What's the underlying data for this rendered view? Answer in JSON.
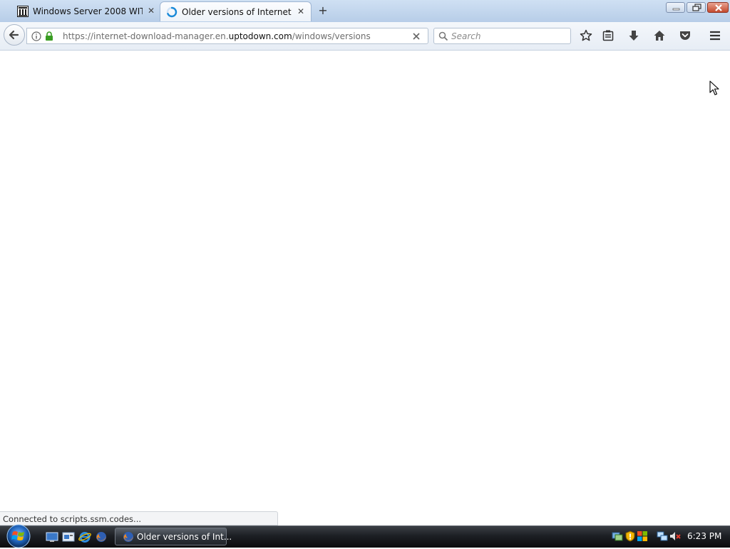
{
  "tabs": [
    {
      "label": "Windows Server 2008 WIT...",
      "active": false,
      "favicon": "library-building-icon"
    },
    {
      "label": "Older versions of Internet ...",
      "active": true,
      "favicon": "loading-spinner-icon"
    }
  ],
  "urlbar": {
    "url_prefix": "https://internet-download-manager.en.",
    "url_host": "uptodown.com",
    "url_path": "/windows/versions"
  },
  "searchbar": {
    "placeholder": "Search"
  },
  "status": {
    "text": "Connected to scripts.ssm.codes..."
  },
  "taskbar": {
    "task_label": "Older versions of Int...",
    "clock": "6:23 PM"
  },
  "colors": {
    "tabstrip": "#cfe0f3",
    "taskbar": "#1c1f24",
    "lock_green": "#3a9d23",
    "spinner_blue": "#0a84ff"
  }
}
